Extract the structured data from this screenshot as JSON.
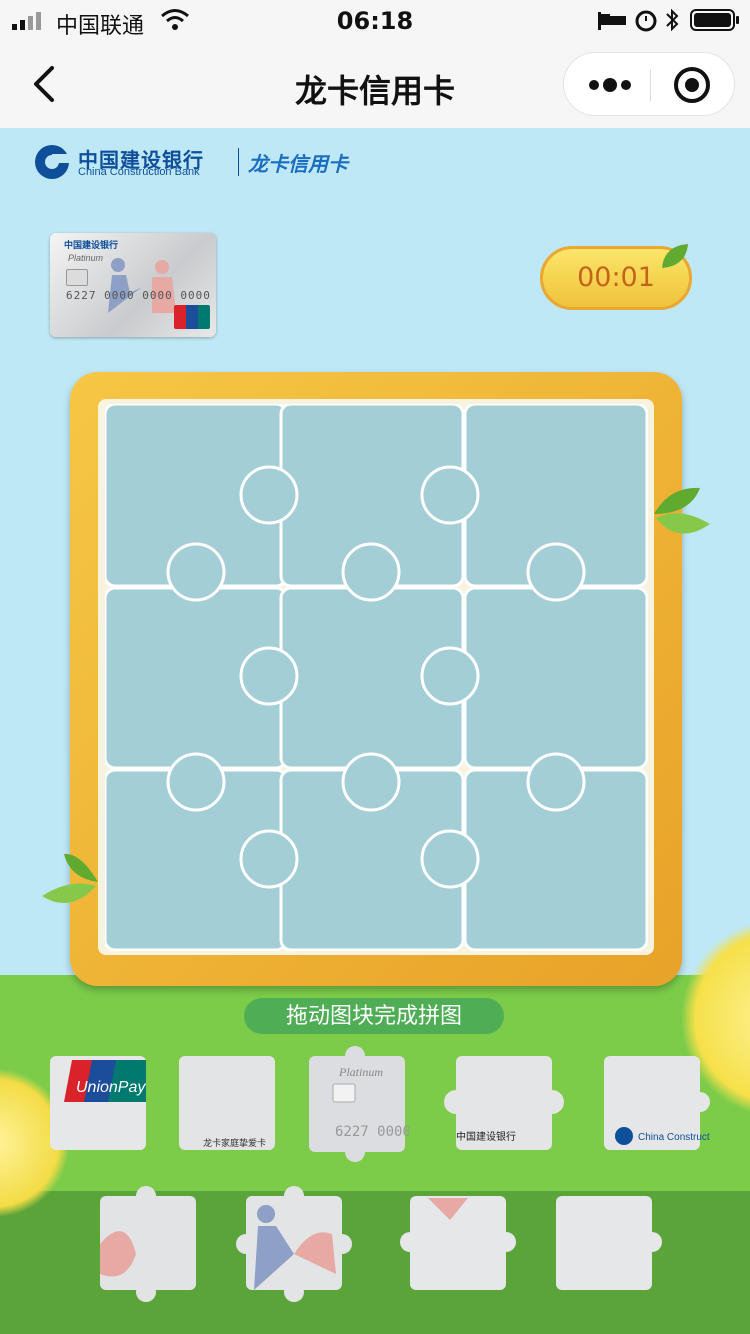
{
  "status_bar": {
    "carrier": "中国联通",
    "time": "06:18"
  },
  "nav": {
    "title": "龙卡信用卡"
  },
  "bank": {
    "name_cn": "中国建设银行",
    "name_en": "China Construction Bank",
    "product": "龙卡信用卡",
    "brand_color": "#0f4f9a"
  },
  "timer": {
    "value": "00:01"
  },
  "puzzle": {
    "grid": "3x3",
    "slot_color": "#a3ced6",
    "frame_color": "#f0b53a"
  },
  "hint": {
    "text": "拖动图块完成拼图"
  },
  "card": {
    "bank_cn": "中国建设银行",
    "bank_en": "China Construction Bank",
    "subtitle": "龙卡家庭挚爱卡",
    "variant": "Platinum",
    "number": "6227 0000 0000 0000",
    "network": "UnionPay 银联"
  },
  "icons": {
    "back": "chevron-left-icon",
    "more": "more-dots-icon",
    "close": "target-circle-icon"
  }
}
